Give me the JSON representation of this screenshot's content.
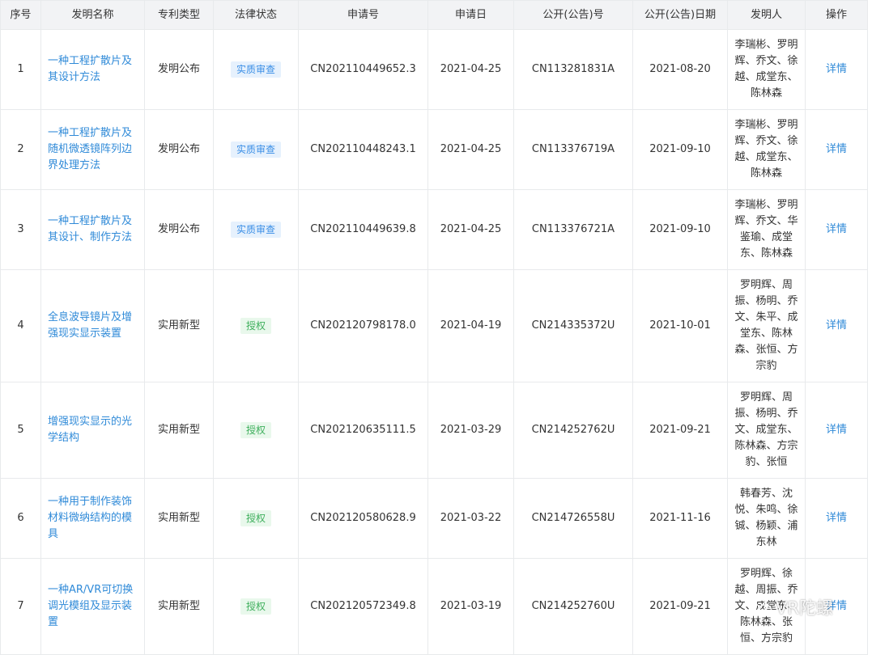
{
  "headers": {
    "seq": "序号",
    "name": "发明名称",
    "type": "专利类型",
    "status": "法律状态",
    "app_no": "申请号",
    "app_date": "申请日",
    "pub_no": "公开(公告)号",
    "pub_date": "公开(公告)日期",
    "inventors": "发明人",
    "action": "操作"
  },
  "rows": [
    {
      "seq": "1",
      "name": "一种工程扩散片及其设计方法",
      "type": "发明公布",
      "status": "实质审查",
      "app_no": "CN202110449652.3",
      "app_date": "2021-04-25",
      "pub_no": "CN113281831A",
      "pub_date": "2021-08-20",
      "inventors": "李瑞彬、罗明辉、乔文、徐越、成堂东、陈林森",
      "action": "详情"
    },
    {
      "seq": "2",
      "name": "一种工程扩散片及随机微透镜阵列边界处理方法",
      "type": "发明公布",
      "status": "实质审查",
      "app_no": "CN202110448243.1",
      "app_date": "2021-04-25",
      "pub_no": "CN113376719A",
      "pub_date": "2021-09-10",
      "inventors": "李瑞彬、罗明辉、乔文、徐越、成堂东、陈林森",
      "action": "详情"
    },
    {
      "seq": "3",
      "name": "一种工程扩散片及其设计、制作方法",
      "type": "发明公布",
      "status": "实质审查",
      "app_no": "CN202110449639.8",
      "app_date": "2021-04-25",
      "pub_no": "CN113376721A",
      "pub_date": "2021-09-10",
      "inventors": "李瑞彬、罗明辉、乔文、华鉴瑜、成堂东、陈林森",
      "action": "详情"
    },
    {
      "seq": "4",
      "name": "全息波导镜片及增强现实显示装置",
      "type": "实用新型",
      "status": "授权",
      "app_no": "CN202120798178.0",
      "app_date": "2021-04-19",
      "pub_no": "CN214335372U",
      "pub_date": "2021-10-01",
      "inventors": "罗明辉、周振、杨明、乔文、朱平、成堂东、陈林森、张恒、方宗豹",
      "action": "详情"
    },
    {
      "seq": "5",
      "name": "增强现实显示的光学结构",
      "type": "实用新型",
      "status": "授权",
      "app_no": "CN202120635111.5",
      "app_date": "2021-03-29",
      "pub_no": "CN214252762U",
      "pub_date": "2021-09-21",
      "inventors": "罗明辉、周振、杨明、乔文、成堂东、陈林森、方宗豹、张恒",
      "action": "详情"
    },
    {
      "seq": "6",
      "name": "一种用于制作装饰材料微纳结构的模具",
      "type": "实用新型",
      "status": "授权",
      "app_no": "CN202120580628.9",
      "app_date": "2021-03-22",
      "pub_no": "CN214726558U",
      "pub_date": "2021-11-16",
      "inventors": "韩春芳、沈悦、朱鸣、徐铖、杨颖、浦东林",
      "action": "详情"
    },
    {
      "seq": "7",
      "name": "一种AR/VR可切换调光模组及显示装置",
      "type": "实用新型",
      "status": "授权",
      "app_no": "CN202120572349.8",
      "app_date": "2021-03-19",
      "pub_no": "CN214252760U",
      "pub_date": "2021-09-21",
      "inventors": "罗明辉、徐越、周振、乔文、成堂东、陈林森、张恒、方宗豹",
      "action": "详情"
    }
  ],
  "status_styles": {
    "实质审查": "review",
    "授权": "granted"
  },
  "watermark": {
    "text": "VR陀螺",
    "icon": "wechat-icon"
  }
}
